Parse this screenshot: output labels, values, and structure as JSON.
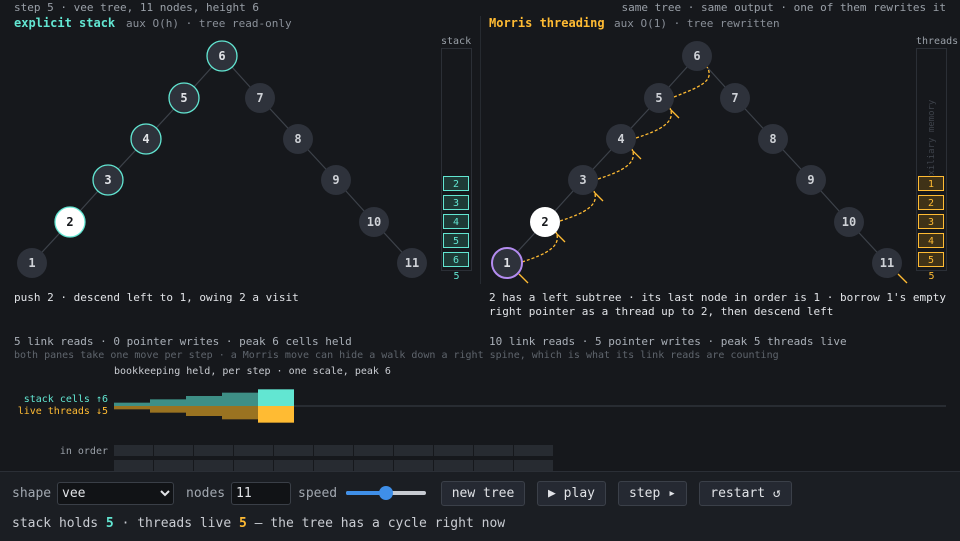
{
  "header": {
    "left": "step 5 · vee tree, 11 nodes, height 6",
    "right": "same tree · same output · one of them rewrites it"
  },
  "left_pane": {
    "title": "explicit stack",
    "subtitle": "aux O(h) · tree read-only",
    "panel_label": "stack",
    "stack_cells": [
      "2",
      "3",
      "4",
      "5",
      "6"
    ],
    "stack_count": "5",
    "message": "push 2 · descend left to 1, owing 2 a visit",
    "stats": "5 link reads · 0 pointer writes · peak 6 cells held"
  },
  "right_pane": {
    "title": "Morris threading",
    "subtitle": "aux O(1) · tree rewritten",
    "panel_label": "threads",
    "panel_watermark": "auxiliary memory",
    "thread_cells": [
      "1",
      "2",
      "3",
      "4",
      "5"
    ],
    "thread_count": "5",
    "message": "2 has a left subtree · its last node in order is 1 · borrow 1's empty right pointer as a thread up to 2, then descend left",
    "stats": "10 link reads · 5 pointer writes · peak 5 threads live"
  },
  "nodes": [
    "6",
    "5",
    "7",
    "4",
    "8",
    "3",
    "9",
    "2",
    "10",
    "1",
    "11"
  ],
  "footer_note": "both panes take one move per step · a Morris move can hide a walk down a right spine, which is what its link reads are counting",
  "bookkeeping": {
    "title": "bookkeeping held, per step · one scale, peak 6",
    "label_stack": "stack cells ↑6",
    "label_threads": "live threads ↓5",
    "stack_series": [
      1,
      2,
      3,
      4,
      5
    ],
    "thread_series": [
      1,
      2,
      3,
      4,
      5
    ],
    "peak": 6
  },
  "inorder": {
    "label": "in order",
    "cells": 11
  },
  "controls": {
    "shape_label": "shape",
    "shape_value": "vee",
    "nodes_label": "nodes",
    "nodes_value": "11",
    "speed_label": "speed",
    "speed_value": 0.5,
    "new_tree": "new tree",
    "play": "▶ play",
    "step": "step ▸",
    "restart": "restart ↺"
  },
  "status": {
    "prefix": "stack holds",
    "stack": "5",
    "middle": "· threads live",
    "threads": "5",
    "suffix": "— the tree has a cycle right now"
  },
  "colors": {
    "teal": "#62e6d2",
    "amber": "#ffbb33",
    "purple": "#b48cf0",
    "node": "#2e323b",
    "bg": "#16181c"
  }
}
